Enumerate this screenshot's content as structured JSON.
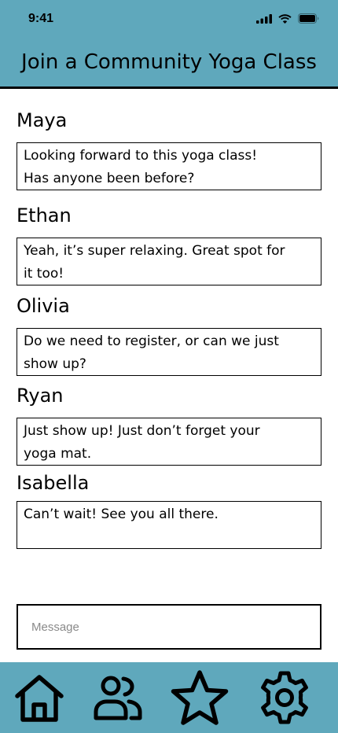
{
  "status_bar": {
    "time": "9:41",
    "icons": [
      "signal-icon",
      "wifi-icon",
      "battery-icon"
    ]
  },
  "header": {
    "title": "Join a Community Yoga Class"
  },
  "messages": [
    {
      "author": "Maya",
      "lines": [
        "Looking forward to this yoga class!",
        "Has anyone been before?"
      ]
    },
    {
      "author": "Ethan",
      "lines": [
        "Yeah, it’s super relaxing. Great spot for",
        "it too!"
      ]
    },
    {
      "author": "Olivia",
      "lines": [
        "Do we need to register, or can we just",
        "show up?"
      ]
    },
    {
      "author": "Ryan",
      "lines": [
        "Just show up! Just don’t forget your",
        "yoga mat."
      ]
    },
    {
      "author": "Isabella",
      "lines": [
        "Can’t wait! See you all there.",
        ""
      ]
    }
  ],
  "composer": {
    "placeholder": "Message",
    "value": ""
  },
  "tab_bar": {
    "items": [
      "home-icon",
      "people-icon",
      "star-icon",
      "gear-icon"
    ]
  },
  "colors": {
    "header_bg": "#5fa8bc",
    "tab_bar_bg": "#5fa8bc",
    "text": "#000000",
    "placeholder": "#8a8a8a"
  }
}
